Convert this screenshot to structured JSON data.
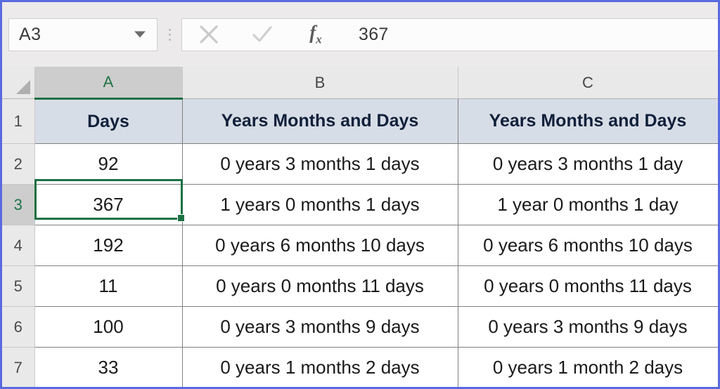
{
  "name_box": {
    "value": "A3",
    "dropdown_icon": "chevron-down-icon"
  },
  "formula_bar": {
    "cancel_icon": "close-icon",
    "confirm_icon": "check-icon",
    "function_icon": "fx-icon",
    "fx_main": "f",
    "fx_sub": "x",
    "value": "367"
  },
  "grid": {
    "select_all_icon": "select-all-triangle-icon",
    "column_headers": [
      "A",
      "B",
      "C"
    ],
    "selected_column": "A",
    "selected_row": "3",
    "selected_cell": "A3",
    "row_numbers": [
      "1",
      "2",
      "3",
      "4",
      "5",
      "6",
      "7"
    ],
    "rows": [
      {
        "num": "1",
        "a": "Days",
        "b": "Years Months and Days",
        "c": "Years Months and Days"
      },
      {
        "num": "2",
        "a": "92",
        "b": "0 years 3 months 1 days",
        "c": "0 years 3 months 1 day"
      },
      {
        "num": "3",
        "a": "367",
        "b": "1 years 0 months 1 days",
        "c": "1 year 0 months 1 day"
      },
      {
        "num": "4",
        "a": "192",
        "b": "0 years 6 months 10 days",
        "c": "0 years 6 months 10 days"
      },
      {
        "num": "5",
        "a": "11",
        "b": "0 years 0 months 11 days",
        "c": "0 years 0 months 11 days"
      },
      {
        "num": "6",
        "a": "100",
        "b": "0 years 3 months 9 days",
        "c": "0 years 3 months 9 days"
      },
      {
        "num": "7",
        "a": "33",
        "b": "0 years 1 months 2 days",
        "c": "0 years 1 month 2 days"
      }
    ]
  },
  "colors": {
    "selection_green": "#1d7044",
    "header_fill": "#d7dde6",
    "frame_blue": "#5a6ae0"
  }
}
